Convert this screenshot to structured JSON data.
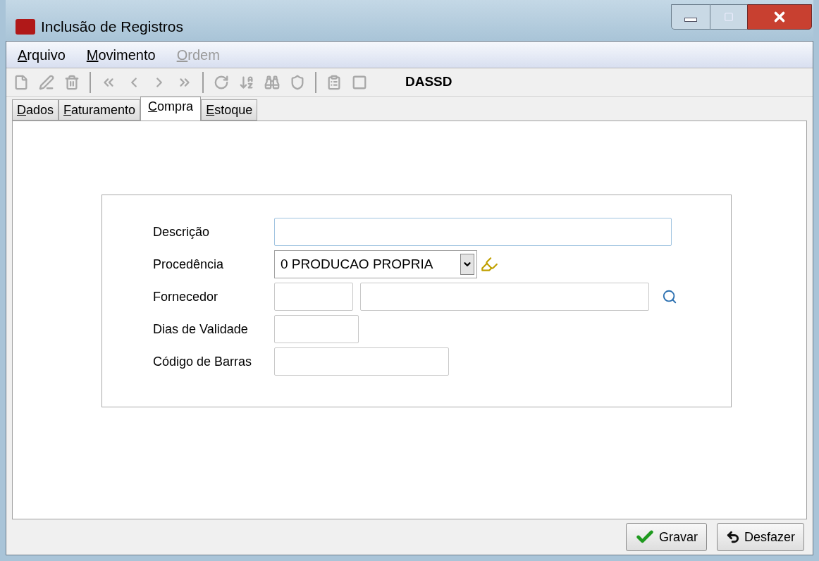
{
  "window": {
    "title": "Inclusão de Registros"
  },
  "menu": [
    {
      "label": "Arquivo",
      "disabled": false
    },
    {
      "label": "Movimento",
      "disabled": false
    },
    {
      "label": "Ordem",
      "disabled": true
    }
  ],
  "toolbar": {
    "label": "DASSD"
  },
  "tabs": [
    {
      "label": "Dados",
      "selected": false
    },
    {
      "label": "Faturamento",
      "selected": false
    },
    {
      "label": "Compra",
      "selected": true
    },
    {
      "label": "Estoque",
      "selected": false
    }
  ],
  "fields": [
    {
      "label": "Descrição",
      "kind": "wide"
    },
    {
      "label": "Procedência",
      "kind": "select",
      "value": "0 PRODUCAO PROPRIA"
    },
    {
      "label": "Fornecedor",
      "kind": "lookup"
    },
    {
      "label": "Dias de Validade",
      "kind": "short"
    },
    {
      "label": "Código de Barras",
      "kind": "medium"
    }
  ],
  "buttons": [
    {
      "label": "Gravar",
      "kind": "save"
    },
    {
      "label": "Desfazer",
      "kind": "undo"
    }
  ]
}
